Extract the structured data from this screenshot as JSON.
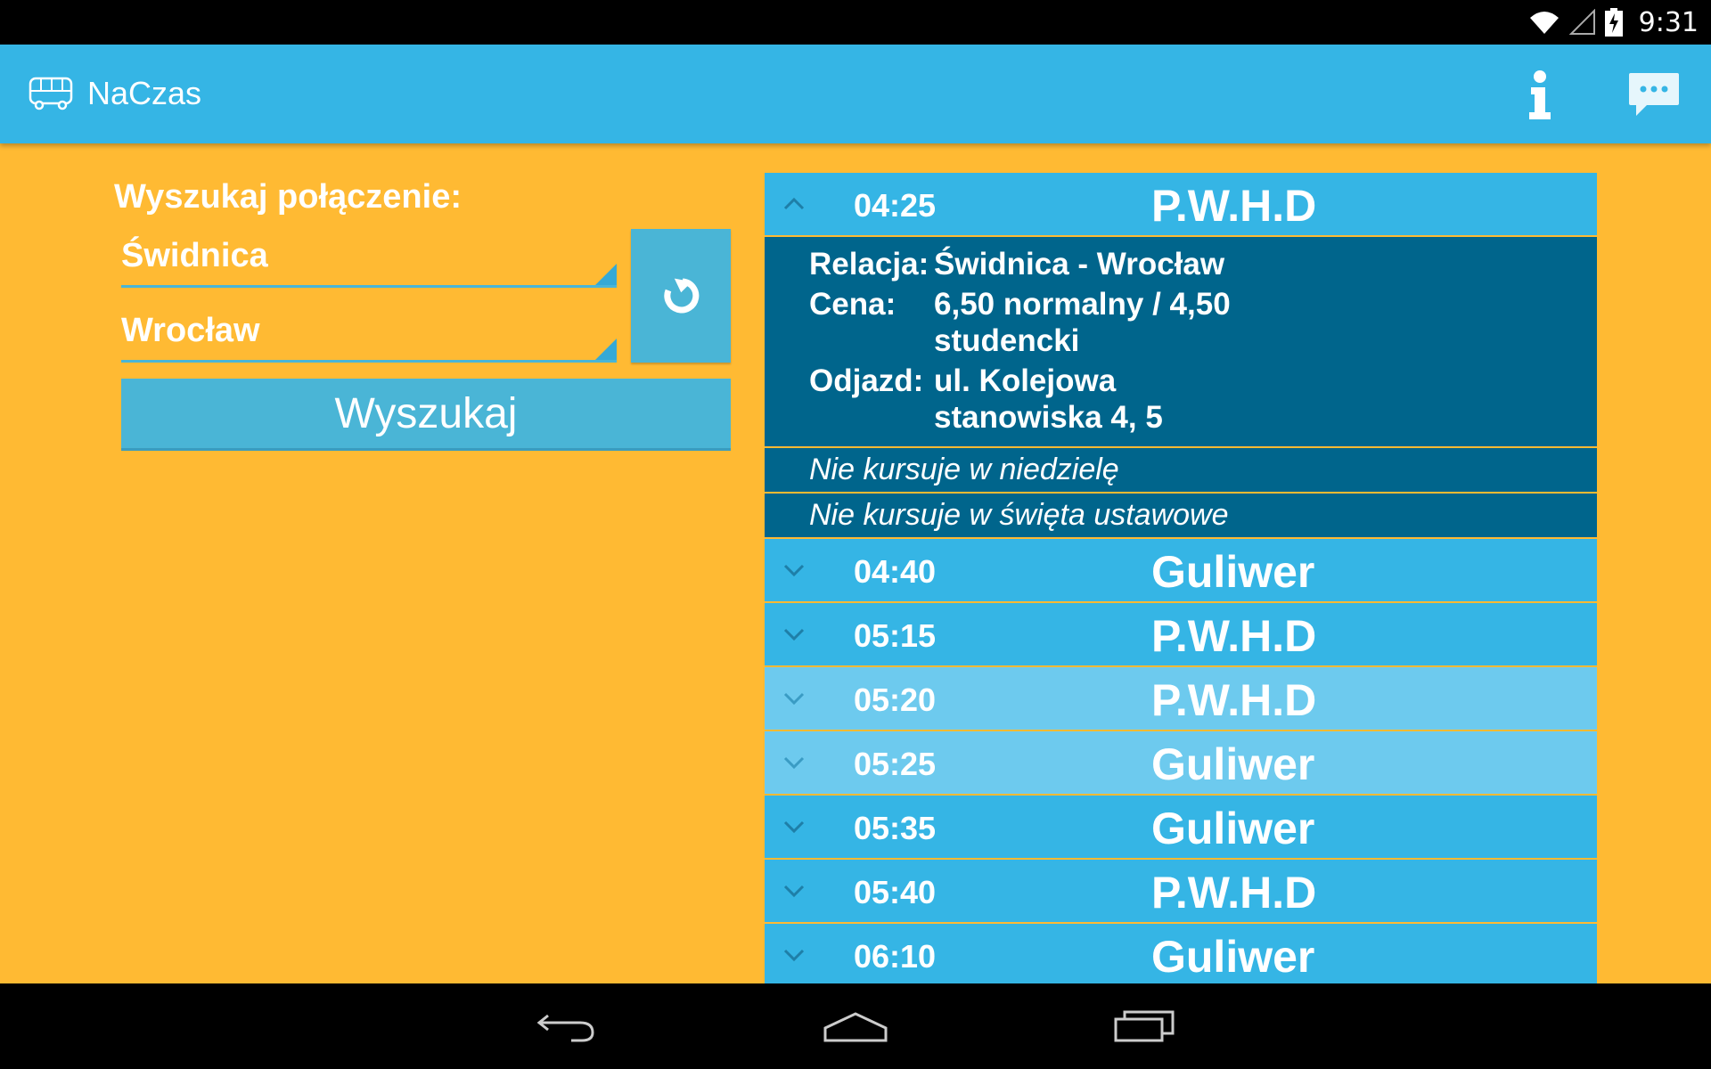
{
  "status_bar": {
    "time": "9:31",
    "icons": [
      "wifi-icon",
      "signal-icon",
      "battery-charging-icon"
    ]
  },
  "action_bar": {
    "app_icon": "bus-icon",
    "title": "NaCzas",
    "actions": [
      "info-icon",
      "chat-icon"
    ]
  },
  "search": {
    "heading": "Wyszukaj połączenie:",
    "from": "Świdnica",
    "to": "Wrocław",
    "swap_icon": "swap-arrow-icon",
    "button_label": "Wyszukaj"
  },
  "expanded": {
    "time": "04:25",
    "carrier": "P.W.H.D",
    "details": [
      {
        "label": "Relacja:",
        "value": "Świdnica - Wrocław"
      },
      {
        "label": "Cena:",
        "value": "6,50 normalny / 4,50 studencki"
      },
      {
        "label": "Odjazd:",
        "value": "ul. Kolejowa stanowiska 4, 5"
      }
    ],
    "notes": [
      "Nie kursuje w niedzielę",
      "Nie kursuje w święta ustawowe"
    ]
  },
  "connections": [
    {
      "time": "04:40",
      "carrier": "Guliwer"
    },
    {
      "time": "05:15",
      "carrier": "P.W.H.D"
    },
    {
      "time": "05:20",
      "carrier": "P.W.H.D"
    },
    {
      "time": "05:25",
      "carrier": "Guliwer"
    },
    {
      "time": "05:35",
      "carrier": "Guliwer"
    },
    {
      "time": "05:40",
      "carrier": "P.W.H.D"
    },
    {
      "time": "06:10",
      "carrier": "Guliwer"
    }
  ],
  "colors": {
    "background": "#FFBA33",
    "accent": "#35B5E5",
    "detail": "#00658C",
    "row_light": "#6DCAEE"
  },
  "nav_bar": [
    "back-icon",
    "home-icon",
    "recents-icon"
  ]
}
